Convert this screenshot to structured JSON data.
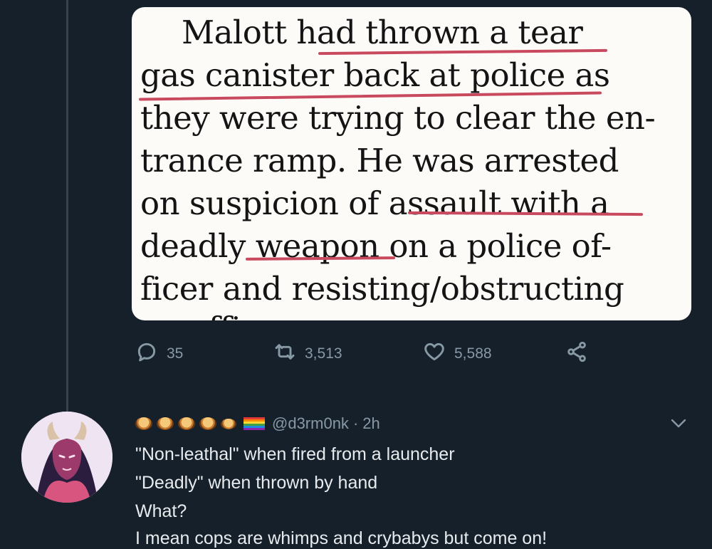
{
  "quoted_image": {
    "lines": [
      "Malott had thrown a tear",
      "gas canister back at police as",
      "they were trying to clear the en-",
      "trance ramp. He was arrested",
      "on suspicion of assault with a",
      "deadly weapon on a police of-",
      "ficer and resisting/obstructing",
      "an officer"
    ]
  },
  "actions": {
    "replies": "35",
    "retweets": "3,513",
    "likes": "5,588"
  },
  "reply": {
    "handle": "@d3rm0nk",
    "separator": "·",
    "time": "2h",
    "lines": [
      "\"Non-leathal\" when fired from a launcher",
      "\"Deadly\" when thrown by hand",
      "What?",
      "I mean cops are whimps and crybabys but come on!"
    ]
  },
  "icons": {
    "reply": "reply-icon",
    "retweet": "retweet-icon",
    "like": "heart-icon",
    "share": "share-icon",
    "more": "chevron-down-icon"
  },
  "colors": {
    "background": "#15202b",
    "underline": "#c94a5e",
    "muted": "#8899a6"
  }
}
